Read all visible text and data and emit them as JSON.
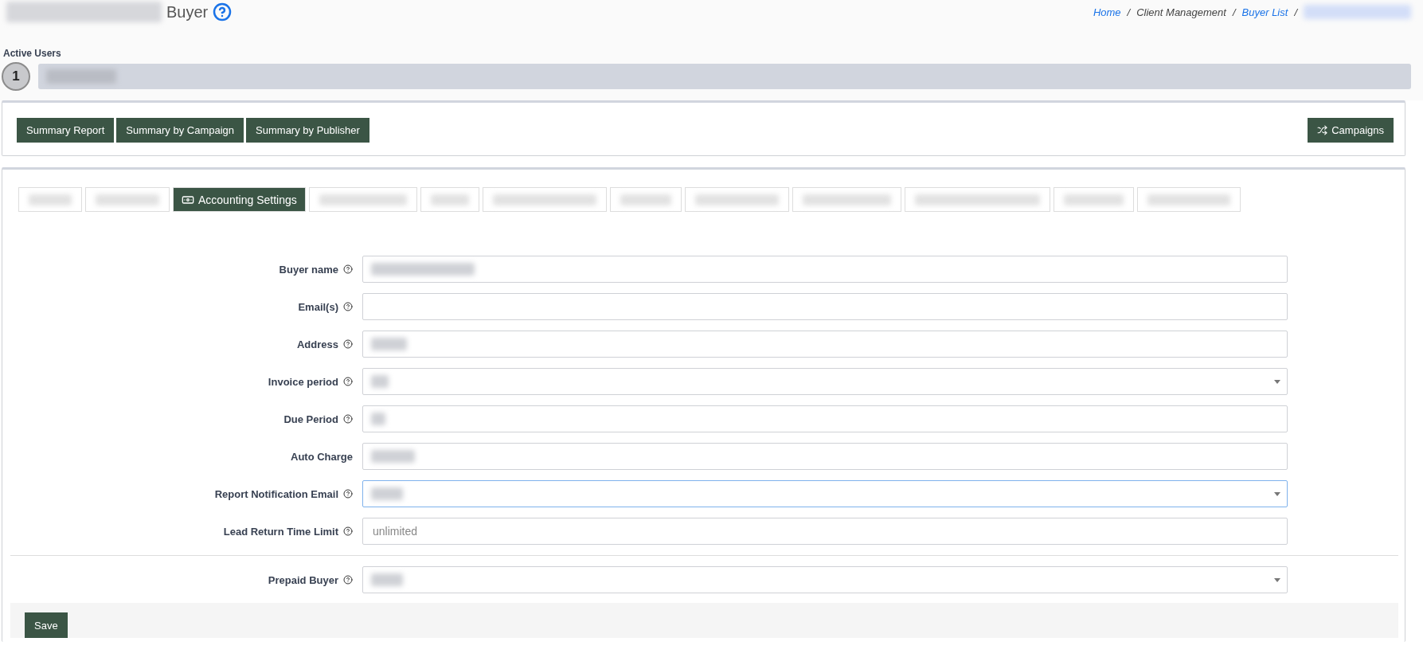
{
  "header": {
    "title_redacted": true,
    "title": "Buyer",
    "help": true
  },
  "breadcrumb": [
    {
      "label": "Home",
      "kind": "link"
    },
    {
      "label": "/",
      "kind": "separator"
    },
    {
      "label": "Client Management",
      "kind": "text"
    },
    {
      "label": "/",
      "kind": "separator"
    },
    {
      "label": "Buyer List",
      "kind": "link"
    },
    {
      "label": "/",
      "kind": "separator"
    },
    {
      "kind": "redacted"
    }
  ],
  "active_users": {
    "label": "Active Users",
    "count": "1",
    "name_redacted": true
  },
  "report_buttons": [
    {
      "label": "Summary Report"
    },
    {
      "label": "Summary by Campaign"
    },
    {
      "label": "Summary by Publisher"
    }
  ],
  "campaigns_button": {
    "label": "Campaigns"
  },
  "tabs": [
    {
      "kind": "redacted",
      "selected": false
    },
    {
      "kind": "redacted",
      "selected": false
    },
    {
      "kind": "labeled",
      "label": "Accounting Settings",
      "selected": true
    },
    {
      "kind": "redacted",
      "selected": false
    },
    {
      "kind": "redacted",
      "selected": false
    },
    {
      "kind": "redacted",
      "selected": false
    },
    {
      "kind": "redacted",
      "selected": false
    },
    {
      "kind": "redacted",
      "selected": false
    },
    {
      "kind": "redacted",
      "selected": false
    },
    {
      "kind": "redacted",
      "selected": false
    },
    {
      "kind": "redacted",
      "selected": false
    },
    {
      "kind": "redacted",
      "selected": false
    }
  ],
  "form": {
    "fields": [
      {
        "label": "Buyer name",
        "help": true,
        "redacted": true,
        "dropdown": false,
        "focused": false
      },
      {
        "label": "Email(s)",
        "help": true,
        "redacted": false,
        "dropdown": false,
        "focused": false
      },
      {
        "label": "Address",
        "help": true,
        "redacted": true,
        "dropdown": false,
        "focused": false
      },
      {
        "label": "Invoice period",
        "help": true,
        "redacted": true,
        "dropdown": true,
        "focused": false
      },
      {
        "label": "Due Period",
        "help": true,
        "redacted": true,
        "dropdown": false,
        "focused": false
      },
      {
        "label": "Auto Charge",
        "help": false,
        "redacted": true,
        "dropdown": false,
        "focused": false
      },
      {
        "label": "Report Notification Email",
        "help": true,
        "redacted": true,
        "dropdown": true,
        "focused": true
      },
      {
        "label": "Lead Return Time Limit",
        "help": true,
        "redacted": false,
        "dropdown": false,
        "focused": false,
        "placeholder": "unlimited"
      }
    ],
    "extra_fields": [
      {
        "label": "Prepaid Buyer",
        "help": true,
        "redacted": true,
        "dropdown": true,
        "focused": false
      }
    ],
    "save_button": {
      "label": "Save"
    }
  }
}
